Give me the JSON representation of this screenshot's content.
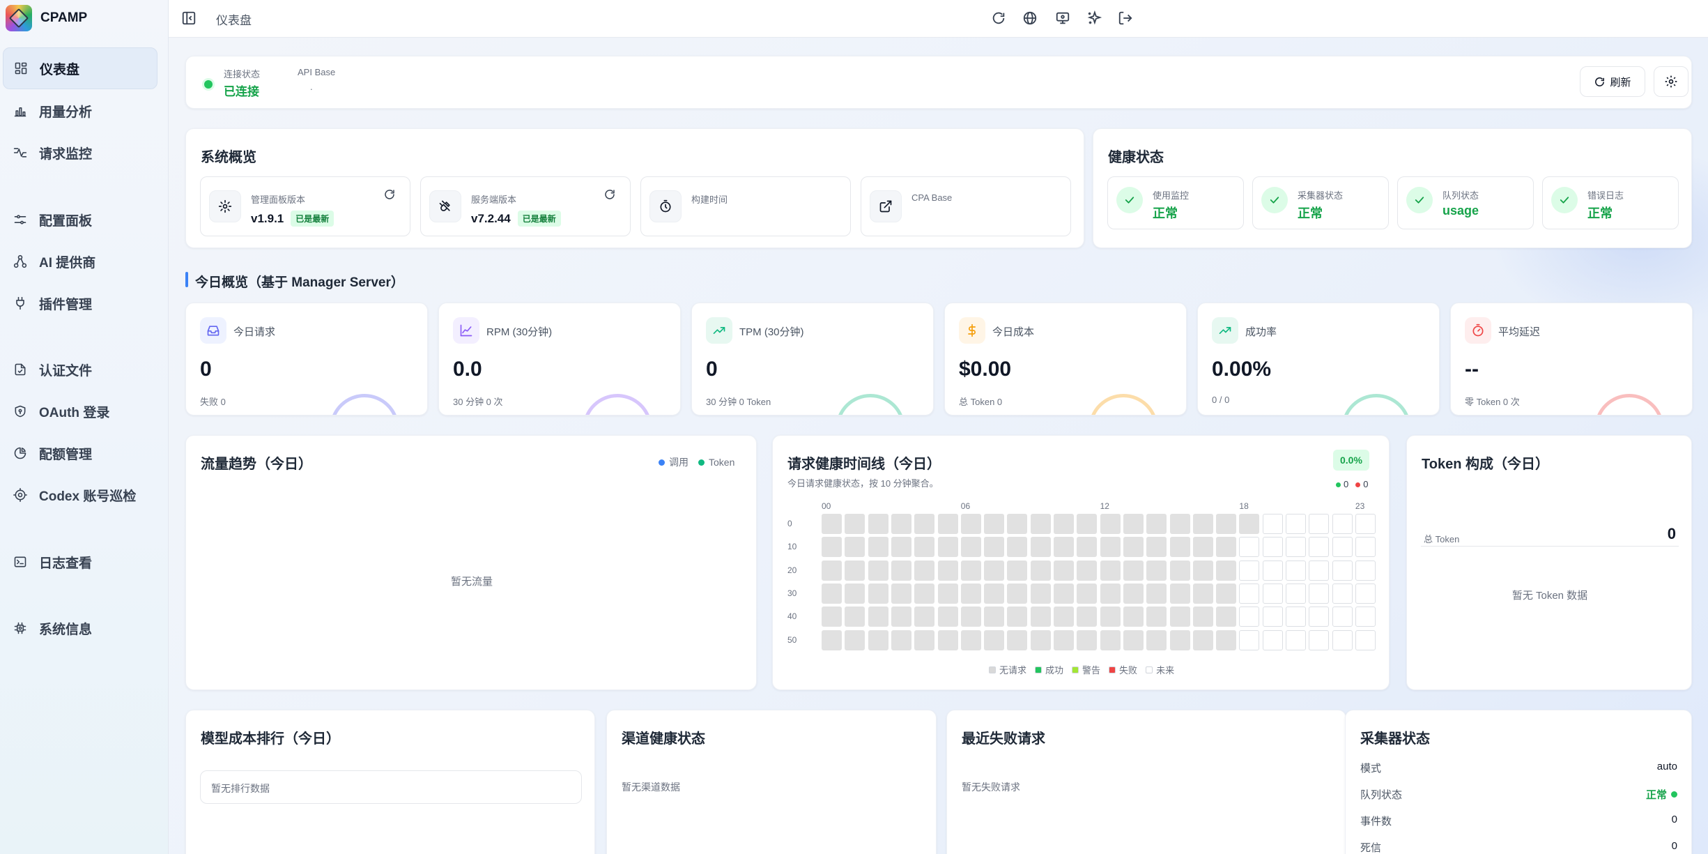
{
  "app": {
    "name": "CPAMP"
  },
  "sidebar": {
    "items": [
      {
        "label": "仪表盘",
        "icon": "dashboard-icon",
        "active": true
      },
      {
        "label": "用量分析",
        "icon": "bar-chart-icon"
      },
      {
        "label": "请求监控",
        "icon": "activity-icon"
      },
      {
        "label": "配置面板",
        "icon": "sliders-icon"
      },
      {
        "label": "AI 提供商",
        "icon": "network-icon"
      },
      {
        "label": "插件管理",
        "icon": "plug-icon"
      },
      {
        "label": "认证文件",
        "icon": "file-check-icon"
      },
      {
        "label": "OAuth 登录",
        "icon": "shield-icon"
      },
      {
        "label": "配额管理",
        "icon": "pie-icon"
      },
      {
        "label": "Codex 账号巡检",
        "icon": "target-icon"
      },
      {
        "label": "日志查看",
        "icon": "terminal-icon"
      },
      {
        "label": "系统信息",
        "icon": "chip-icon"
      }
    ]
  },
  "topbar": {
    "breadcrumb": "仪表盘"
  },
  "connection": {
    "status_label": "连接状态",
    "status_value": "已连接",
    "api_label": "API Base",
    "api_value": ".",
    "refresh_label": "刷新"
  },
  "overview": {
    "title": "系统概览",
    "items": [
      {
        "label": "管理面板版本",
        "value": "v1.9.1",
        "badge": "已是最新"
      },
      {
        "label": "服务端版本",
        "value": "v7.2.44",
        "badge": "已是最新"
      },
      {
        "label": "构建时间",
        "value": ""
      },
      {
        "label": "CPA Base",
        "value": ""
      }
    ]
  },
  "health": {
    "title": "健康状态",
    "items": [
      {
        "label": "使用监控",
        "value": "正常"
      },
      {
        "label": "采集器状态",
        "value": "正常"
      },
      {
        "label": "队列状态",
        "value": "usage"
      },
      {
        "label": "错误日志",
        "value": "正常"
      }
    ]
  },
  "today": {
    "title": "今日概览（基于 Manager Server）",
    "kpis": [
      {
        "label": "今日请求",
        "value": "0",
        "sub": "失败 0",
        "color": "#6366f1",
        "bg": "#eef2ff",
        "icon": "inbox-icon"
      },
      {
        "label": "RPM (30分钟)",
        "value": "0.0",
        "sub": "30 分钟 0 次",
        "color": "#8b5cf6",
        "bg": "#f3efff",
        "icon": "line-chart-icon"
      },
      {
        "label": "TPM (30分钟)",
        "value": "0",
        "sub": "30 分钟 0 Token",
        "color": "#10b981",
        "bg": "#e7f8f1",
        "icon": "trending-up-icon"
      },
      {
        "label": "今日成本",
        "value": "$0.00",
        "sub": "总 Token 0",
        "color": "#f59e0b",
        "bg": "#fff5e6",
        "icon": "dollar-icon"
      },
      {
        "label": "成功率",
        "value": "0.00%",
        "sub": "0 / 0",
        "color": "#10b981",
        "bg": "#e7f8f1",
        "icon": "trending-up-icon"
      },
      {
        "label": "平均延迟",
        "value": "--",
        "sub": "零 Token 0 次",
        "color": "#ef4444",
        "bg": "#feeeee",
        "icon": "timer-icon"
      }
    ]
  },
  "traffic": {
    "title": "流量趋势（今日）",
    "legend_calls": "调用",
    "legend_token": "Token",
    "empty": "暂无流量",
    "color_calls": "#3b82f6",
    "color_token": "#10b981"
  },
  "timeline": {
    "title": "请求健康时间线（今日）",
    "subtitle": "今日请求健康状态，按 10 分钟聚合。",
    "rate": "0.0%",
    "success_count": "0",
    "fail_count": "0",
    "hour_labels": [
      "00",
      "06",
      "12",
      "18",
      "23"
    ],
    "row_labels": [
      "0",
      "10",
      "20",
      "30",
      "40",
      "50"
    ],
    "elapsed_hours": 18,
    "legend": [
      {
        "label": "无请求",
        "color": "#d9d9d9"
      },
      {
        "label": "成功",
        "color": "#22c55e"
      },
      {
        "label": "警告",
        "color": "#a3e635"
      },
      {
        "label": "失败",
        "color": "#ef4444"
      },
      {
        "label": "未来",
        "color": "#ffffff"
      }
    ]
  },
  "token": {
    "title": "Token 构成（今日）",
    "total_label": "总 Token",
    "total_value": "0",
    "empty": "暂无 Token 数据"
  },
  "model_cost": {
    "title": "模型成本排行（今日）",
    "empty": "暂无排行数据"
  },
  "channel": {
    "title": "渠道健康状态",
    "empty": "暂无渠道数据"
  },
  "failures": {
    "title": "最近失败请求",
    "empty": "暂无失败请求"
  },
  "collector": {
    "title": "采集器状态",
    "rows": [
      {
        "label": "模式",
        "value": "auto"
      },
      {
        "label": "队列状态",
        "value": "正常"
      },
      {
        "label": "事件数",
        "value": "0"
      },
      {
        "label": "死信",
        "value": "0"
      }
    ]
  }
}
